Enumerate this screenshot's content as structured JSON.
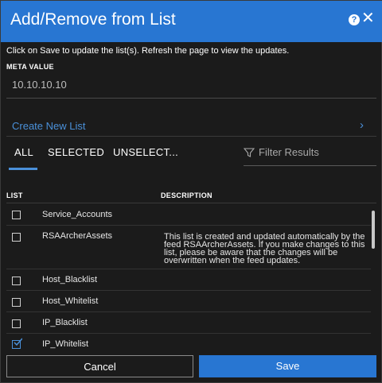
{
  "dialog": {
    "title": "Add/Remove from List",
    "help_icon": "help-circle-icon",
    "close_icon": "close-icon",
    "instructions": "Click on Save to update the list(s). Refresh the page to view the updates.",
    "meta_label": "META VALUE",
    "meta_value": "10.10.10.10",
    "create_new_list": "Create New List",
    "create_chevron": "chevron-right-icon",
    "tabs": [
      {
        "label": "ALL",
        "active": true
      },
      {
        "label": "SELECTED",
        "active": false
      },
      {
        "label": "UNSELECT...",
        "active": false
      }
    ],
    "filter_placeholder": "Filter Results",
    "columns": {
      "list": "LIST",
      "description": "DESCRIPTION"
    },
    "rows": [
      {
        "name": "Service_Accounts",
        "description": "",
        "checked": false
      },
      {
        "name": "RSAArcherAssets",
        "description": "This list is created and updated automatically by the feed RSAArcherAssets. If you make changes to this list, please be aware that the changes will be overwritten when the feed updates.",
        "checked": false
      },
      {
        "name": "Host_Blacklist",
        "description": "",
        "checked": false
      },
      {
        "name": "Host_Whitelist",
        "description": "",
        "checked": false
      },
      {
        "name": "IP_Blacklist",
        "description": "",
        "checked": false
      },
      {
        "name": "IP_Whitelist",
        "description": "",
        "checked": true
      }
    ],
    "cancel_label": "Cancel",
    "save_label": "Save",
    "colors": {
      "accent": "#2876d2",
      "link": "#4a90d9",
      "background": "#1b1b1b"
    }
  }
}
